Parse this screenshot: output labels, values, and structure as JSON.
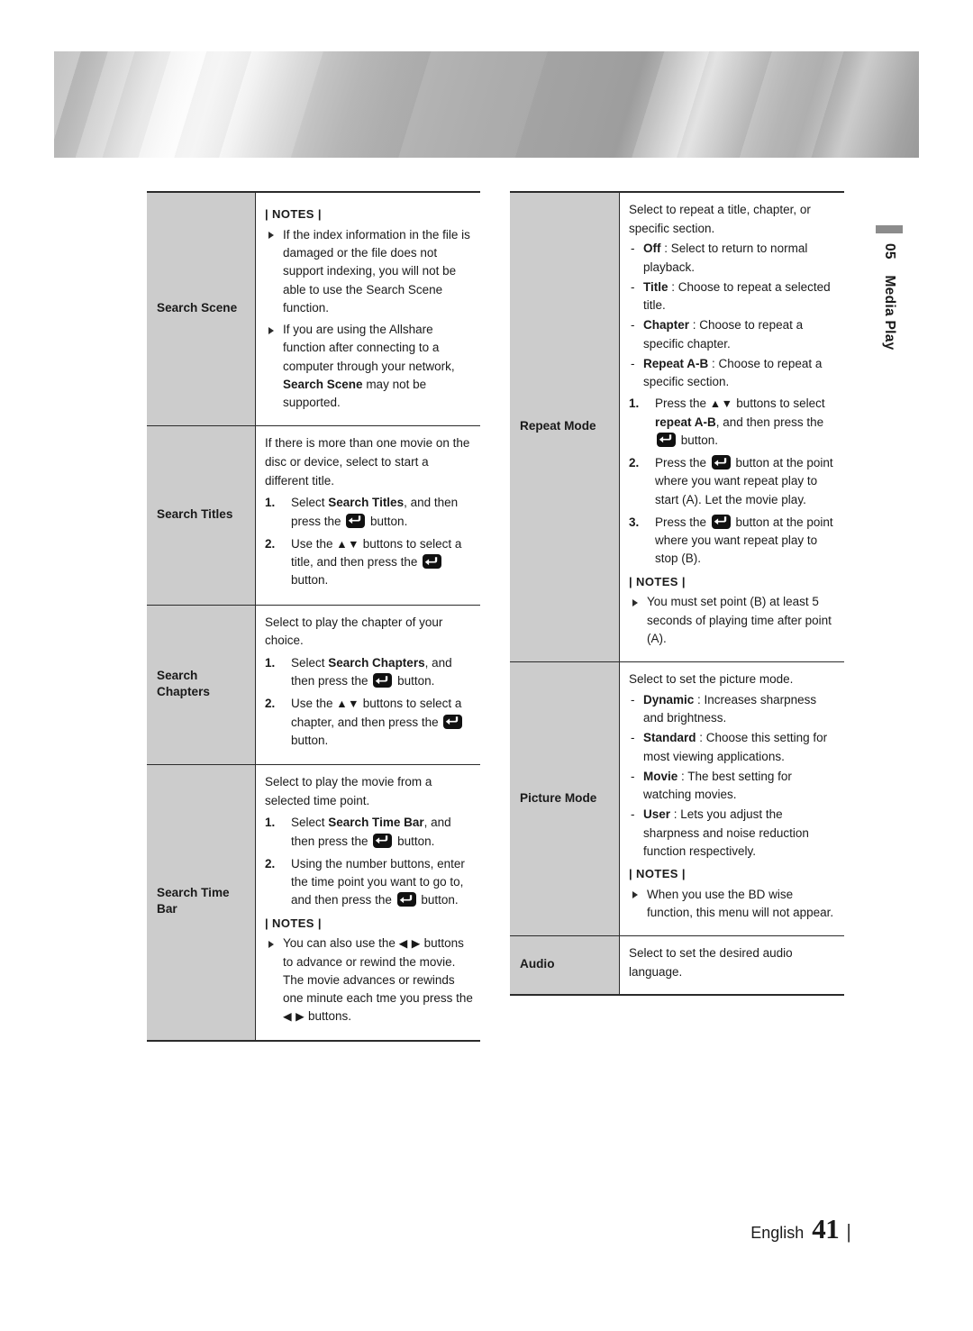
{
  "page": {
    "side_tab": {
      "number": "05",
      "title": "Media Play"
    },
    "footer": {
      "language": "English",
      "page_number": "41",
      "rule": "|"
    },
    "colors": {
      "label_fill": "#cccccc",
      "rule": "#2b2b2b",
      "tab_bar": "#8c8c8c"
    },
    "icons": {
      "enter_button": "enter-button-icon",
      "up_down_arrows": "▲▼",
      "left_right_arrows": "◀ ▶",
      "bullet": "triangle-bullet-icon"
    },
    "notes_label": "NOTES",
    "notes_bar": "|"
  },
  "left_table": {
    "rows": [
      {
        "label": "Search Scene",
        "notes_head": "| NOTES |",
        "bullets": [
          [
            {
              "t": "If the index information in the file is damaged or the file does not support indexing, you will not be able to use the Search Scene function."
            }
          ],
          [
            {
              "t": "If you are using the Allshare function after connecting to a computer through your network, "
            },
            {
              "t": "Search Scene",
              "b": true
            },
            {
              "t": " may not be supported."
            }
          ]
        ]
      },
      {
        "label": "Search Titles",
        "para": "If there is more than one movie on the disc or device, select to start a different title.",
        "steps": [
          [
            {
              "t": "Select "
            },
            {
              "t": "Search Titles",
              "b": true
            },
            {
              "t": ", and then press the "
            },
            {
              "icon": "enter"
            },
            {
              "t": " button."
            }
          ],
          [
            {
              "t": "Use the "
            },
            {
              "t": "▲▼",
              "arrows": true
            },
            {
              "t": " buttons to select a title, and then press the "
            },
            {
              "icon": "enter"
            },
            {
              "t": " button."
            }
          ]
        ]
      },
      {
        "label": "Search Chapters",
        "para": "Select to play the chapter of your choice.",
        "steps": [
          [
            {
              "t": "Select "
            },
            {
              "t": "Search Chapters",
              "b": true
            },
            {
              "t": ", and then press the "
            },
            {
              "icon": "enter"
            },
            {
              "t": " button."
            }
          ],
          [
            {
              "t": "Use the "
            },
            {
              "t": "▲▼",
              "arrows": true
            },
            {
              "t": " buttons to select a chapter, and then press the "
            },
            {
              "icon": "enter"
            },
            {
              "t": " button."
            }
          ]
        ]
      },
      {
        "label": "Search Time Bar",
        "para": "Select to play the movie from a selected time point.",
        "steps": [
          [
            {
              "t": "Select "
            },
            {
              "t": "Search Time Bar",
              "b": true
            },
            {
              "t": ", and then press the "
            },
            {
              "icon": "enter"
            },
            {
              "t": " button."
            }
          ],
          [
            {
              "t": "Using the number buttons, enter the time point you want to go to, and then press the "
            },
            {
              "icon": "enter"
            },
            {
              "t": " button."
            }
          ]
        ],
        "notes_head": "| NOTES |",
        "bullets": [
          [
            {
              "t": "You can also use the "
            },
            {
              "t": "◀ ▶",
              "arrows": true
            },
            {
              "t": " buttons to advance or rewind the movie. The movie advances or rewinds one minute each tme you press the "
            },
            {
              "t": "◀ ▶",
              "arrows": true
            },
            {
              "t": " buttons."
            }
          ]
        ]
      }
    ]
  },
  "right_table": {
    "rows": [
      {
        "label": "Repeat Mode",
        "para": "Select to repeat a title, chapter, or specific section.",
        "dashes": [
          [
            {
              "t": "Off",
              "b": true
            },
            {
              "t": " : Select to return to normal playback."
            }
          ],
          [
            {
              "t": "Title",
              "b": true
            },
            {
              "t": " : Choose to repeat a selected title."
            }
          ],
          [
            {
              "t": "Chapter",
              "b": true
            },
            {
              "t": " : Choose to repeat a specific chapter."
            }
          ],
          [
            {
              "t": "Repeat A-B",
              "b": true
            },
            {
              "t": " : Choose to repeat a specific section."
            }
          ]
        ],
        "steps": [
          [
            {
              "t": "Press the "
            },
            {
              "t": "▲▼",
              "arrows": true
            },
            {
              "t": " buttons to select "
            },
            {
              "t": "repeat A-B",
              "b": true
            },
            {
              "t": ", and then press the "
            },
            {
              "icon": "enter"
            },
            {
              "t": " button."
            }
          ],
          [
            {
              "t": "Press the "
            },
            {
              "icon": "enter"
            },
            {
              "t": " button at the point where you want repeat play to start (A). Let the movie play."
            }
          ],
          [
            {
              "t": "Press the "
            },
            {
              "icon": "enter"
            },
            {
              "t": " button at the point where you want repeat play to stop (B)."
            }
          ]
        ],
        "notes_head": "| NOTES |",
        "bullets": [
          [
            {
              "t": "You must set point (B) at least 5 seconds of playing time after point (A)."
            }
          ]
        ]
      },
      {
        "label": "Picture Mode",
        "para": "Select to set the picture mode.",
        "dashes": [
          [
            {
              "t": "Dynamic",
              "b": true
            },
            {
              "t": " : Increases sharpness and brightness."
            }
          ],
          [
            {
              "t": "Standard",
              "b": true
            },
            {
              "t": " : Choose this setting for most viewing applications."
            }
          ],
          [
            {
              "t": "Movie",
              "b": true
            },
            {
              "t": " : The best setting for watching movies."
            }
          ],
          [
            {
              "t": "User",
              "b": true
            },
            {
              "t": " : Lets you adjust the sharpness and noise reduction function respectively."
            }
          ]
        ],
        "notes_head": "| NOTES |",
        "bullets": [
          [
            {
              "t": "When you use the BD wise function, this menu will not appear."
            }
          ]
        ]
      },
      {
        "label": "Audio",
        "para": "Select to set the desired audio language."
      }
    ]
  }
}
